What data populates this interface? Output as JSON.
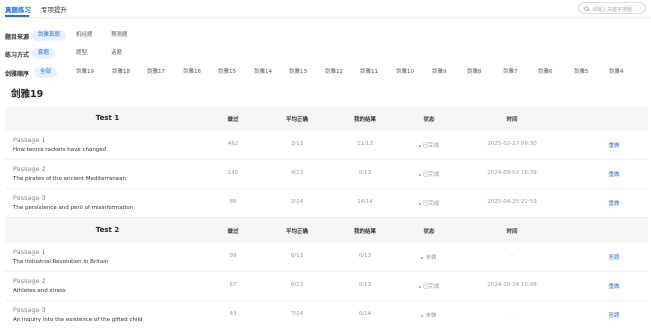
{
  "tabs": [
    {
      "label": "真题练习",
      "active": true
    },
    {
      "label": "专项提升",
      "active": false
    }
  ],
  "search": {
    "placeholder": "请输入关键字搜题"
  },
  "filters": {
    "source": {
      "label": "题目来源",
      "options": [
        "剑雅真题",
        "机经题",
        "预测题"
      ],
      "selected": 0
    },
    "mode": {
      "label": "练习方式",
      "options": [
        "套题",
        "题型",
        "话题"
      ],
      "selected": 0
    },
    "order": {
      "label": "剑雅顺序",
      "options": [
        "全部",
        "剑雅19",
        "剑雅18",
        "剑雅17",
        "剑雅16",
        "剑雅15",
        "剑雅14",
        "剑雅13",
        "剑雅12",
        "剑雅11",
        "剑雅10",
        "剑雅9",
        "剑雅8",
        "剑雅7",
        "剑雅6",
        "剑雅5",
        "剑雅4"
      ],
      "selected": 0
    }
  },
  "section_title": "剑雅19",
  "columns": {
    "done": "做过",
    "avg": "平均正确",
    "mine": "我的结果",
    "status": "状态",
    "time": "时间"
  },
  "groups": [
    {
      "title": "Test 1",
      "rows": [
        {
          "passage": "Passage 1",
          "title": "How tennis rackets have changed",
          "done": "462",
          "avg": "3/13",
          "mine": "11/13",
          "status": "已完成",
          "time": "2025-02-27 09:30",
          "action": "重做"
        },
        {
          "passage": "Passage 2",
          "title": "The pirates of the ancient Mediterranean",
          "done": "145",
          "avg": "4/13",
          "mine": "0/13",
          "status": "已完成",
          "time": "2024-09-02 16:39",
          "action": "重做"
        },
        {
          "passage": "Passage 3",
          "title": "The persistence and peril of misinformation",
          "done": "88",
          "avg": "3/14",
          "mine": "14/14",
          "status": "已完成",
          "time": "2025-04-25 22:59",
          "action": "重做"
        }
      ]
    },
    {
      "title": "Test 2",
      "rows": [
        {
          "passage": "Passage 1",
          "title": "The Industrial Revolution in Britain",
          "done": "99",
          "avg": "6/13",
          "mine": "0/13",
          "status": "未做",
          "time": "-",
          "action": "答题"
        },
        {
          "passage": "Passage 2",
          "title": "Athletes and stress",
          "done": "67",
          "avg": "6/13",
          "mine": "0/13",
          "status": "已完成",
          "time": "2024-10-24 10:48",
          "action": "重做"
        },
        {
          "passage": "Passage 3",
          "title": "An inquiry into the existence of the gifted child",
          "done": "43",
          "avg": "7/14",
          "mine": "0/14",
          "status": "未做",
          "time": "-",
          "action": "答题"
        }
      ]
    }
  ],
  "colors": {
    "accent": "#1a73e8",
    "accent_bg": "#e8f1fe",
    "header_bg": "#f5f6f8"
  },
  "icons": {
    "search": "search-icon"
  }
}
